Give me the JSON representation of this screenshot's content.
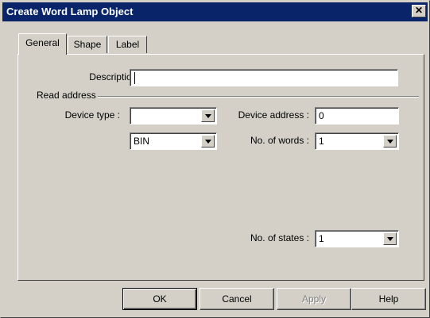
{
  "window": {
    "title": "Create Word Lamp Object",
    "close_glyph": "✕"
  },
  "tabs": [
    {
      "label": "General",
      "active": true
    },
    {
      "label": "Shape",
      "active": false
    },
    {
      "label": "Label",
      "active": false
    }
  ],
  "general": {
    "description_label": "Description :",
    "description_value": "",
    "read_address_label": "Read address",
    "device_type_label": "Device type :",
    "device_type_value": "",
    "format_value": "BIN",
    "device_address_label": "Device address :",
    "device_address_value": "0",
    "num_words_label": "No. of words :",
    "num_words_value": "1",
    "num_states_label": "No. of states :",
    "num_states_value": "1"
  },
  "buttons": {
    "ok": "OK",
    "cancel": "Cancel",
    "apply": "Apply",
    "help": "Help"
  }
}
